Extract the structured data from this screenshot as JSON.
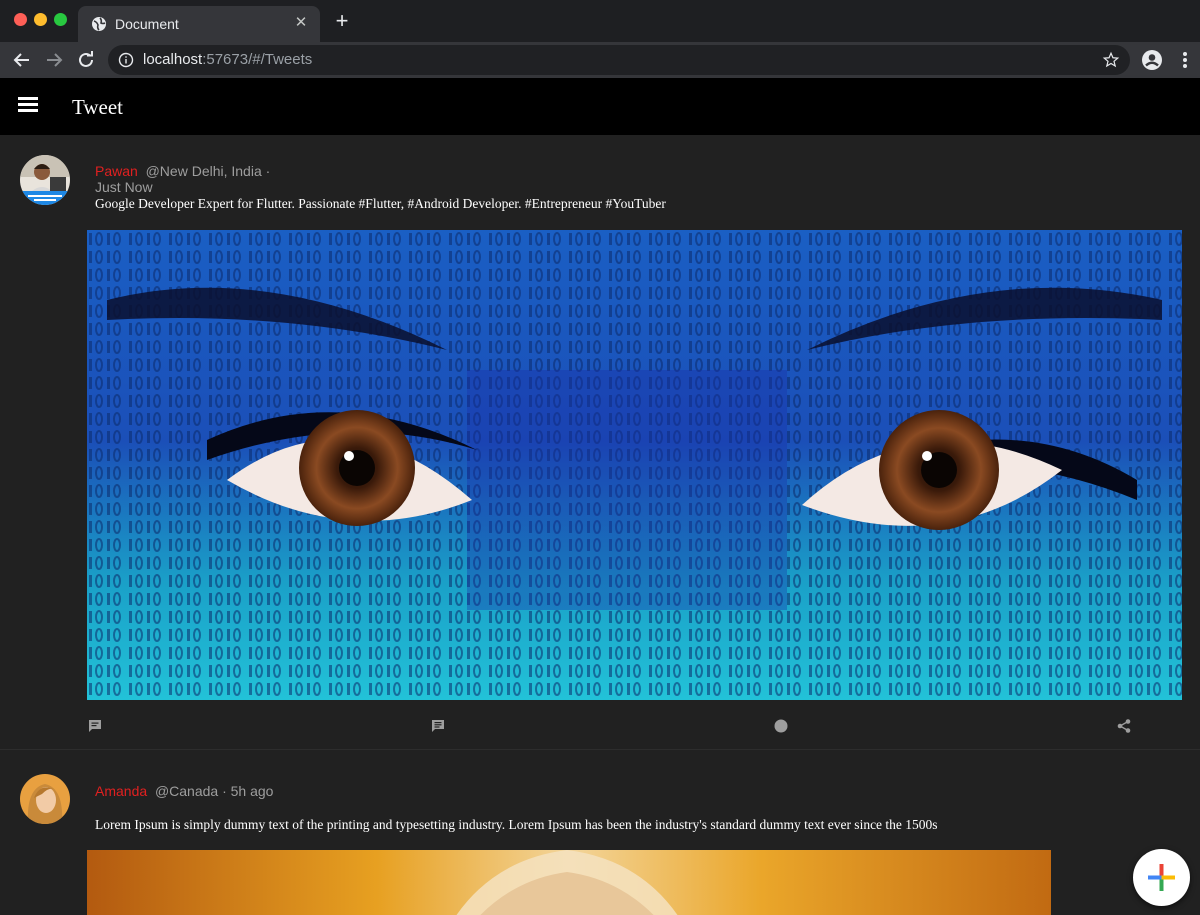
{
  "browser": {
    "tab_title": "Document",
    "tab_close_glyph": "✕",
    "new_tab_glyph": "+",
    "url_host": "localhost",
    "url_rest": ":57673/#/Tweets"
  },
  "appbar": {
    "title": "Tweet"
  },
  "tweets": [
    {
      "name": "Pawan",
      "handle": "@New Delhi, India ·",
      "time": "Just Now",
      "text": "Google Developer Expert for Flutter. Passionate #Flutter, #Android Developer. #Entrepreneur #YouTuber",
      "image": "blue-binary-eyes-image",
      "actions": [
        "comment-icon",
        "chat-icon",
        "dot-icon",
        "share-icon"
      ]
    },
    {
      "name": "Amanda",
      "handle": "@Canada · 5h ago",
      "text": "Lorem Ipsum is simply dummy text of the printing and typesetting industry. Lorem Ipsum has been the industry's standard dummy text ever since the 1500s",
      "image": "woman-portrait-image"
    }
  ],
  "fab": {
    "icon": "plus-icon"
  },
  "colors": {
    "app_bg": "#212121",
    "appbar_bg": "#000000",
    "name_color": "#e02020",
    "meta_color": "#9e9e9e"
  }
}
